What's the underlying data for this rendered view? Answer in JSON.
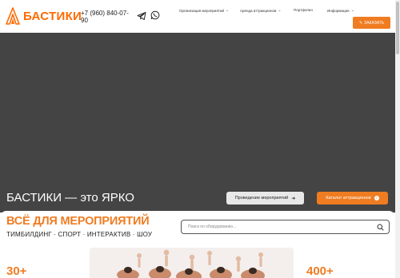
{
  "header": {
    "brand": "БАСТИКИ",
    "phone": "+7 (960) 840-07-90",
    "nav": [
      {
        "label": "Организация мероприятий",
        "has_dropdown": true
      },
      {
        "label": "Аренда аттракционов",
        "has_dropdown": true
      },
      {
        "label": "Портфолио",
        "has_dropdown": false
      },
      {
        "label": "Информация",
        "has_dropdown": true
      }
    ],
    "order_label": "ЗАКАЗАТЬ",
    "icons": {
      "messenger_1": "telegram-icon",
      "messenger_2": "whatsapp-icon",
      "order": "pencil-icon"
    }
  },
  "hero": {
    "title": "БАСТИКИ — это ЯРКО",
    "events_button": "Проведение мероприятий",
    "catalog_button": "Каталог аттракционов"
  },
  "catalog": {
    "title": "ВСЁ ДЛЯ МЕРОПРИЯТИЙ",
    "subtitle": "ТИМБИЛДИНГ · СПОРТ · ИНТЕРАКТИВ · ШОУ",
    "search_placeholder": "Поиск по оборудованию...",
    "stat_left": "30+",
    "stat_right": "400+"
  },
  "colors": {
    "accent": "#f07c22",
    "hero_bg": "#444444"
  }
}
